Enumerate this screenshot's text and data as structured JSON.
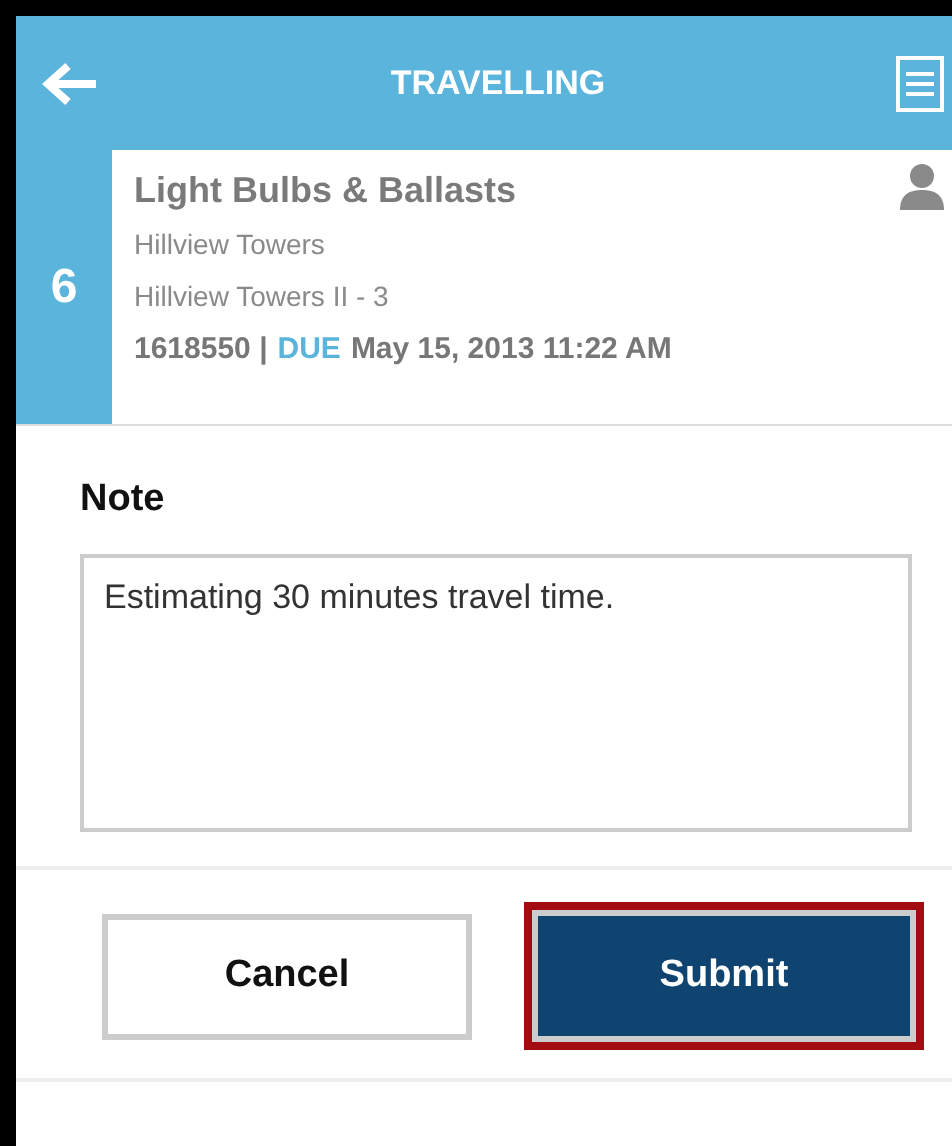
{
  "header": {
    "title": "TRAVELLING"
  },
  "work_order": {
    "number": "6",
    "title": "Light Bulbs & Ballasts",
    "location": "Hillview Towers",
    "sublocation": "Hillview Towers II - 3",
    "id": "1618550 |",
    "due_label": "DUE",
    "due_date": "May 15, 2013 11:22 AM"
  },
  "note": {
    "label": "Note",
    "value": "Estimating 30 minutes travel time."
  },
  "buttons": [
    {
      "label": "Cancel",
      "kind": "secondary",
      "highlighted": false
    },
    {
      "label": "Submit",
      "kind": "primary",
      "highlighted": true
    }
  ]
}
